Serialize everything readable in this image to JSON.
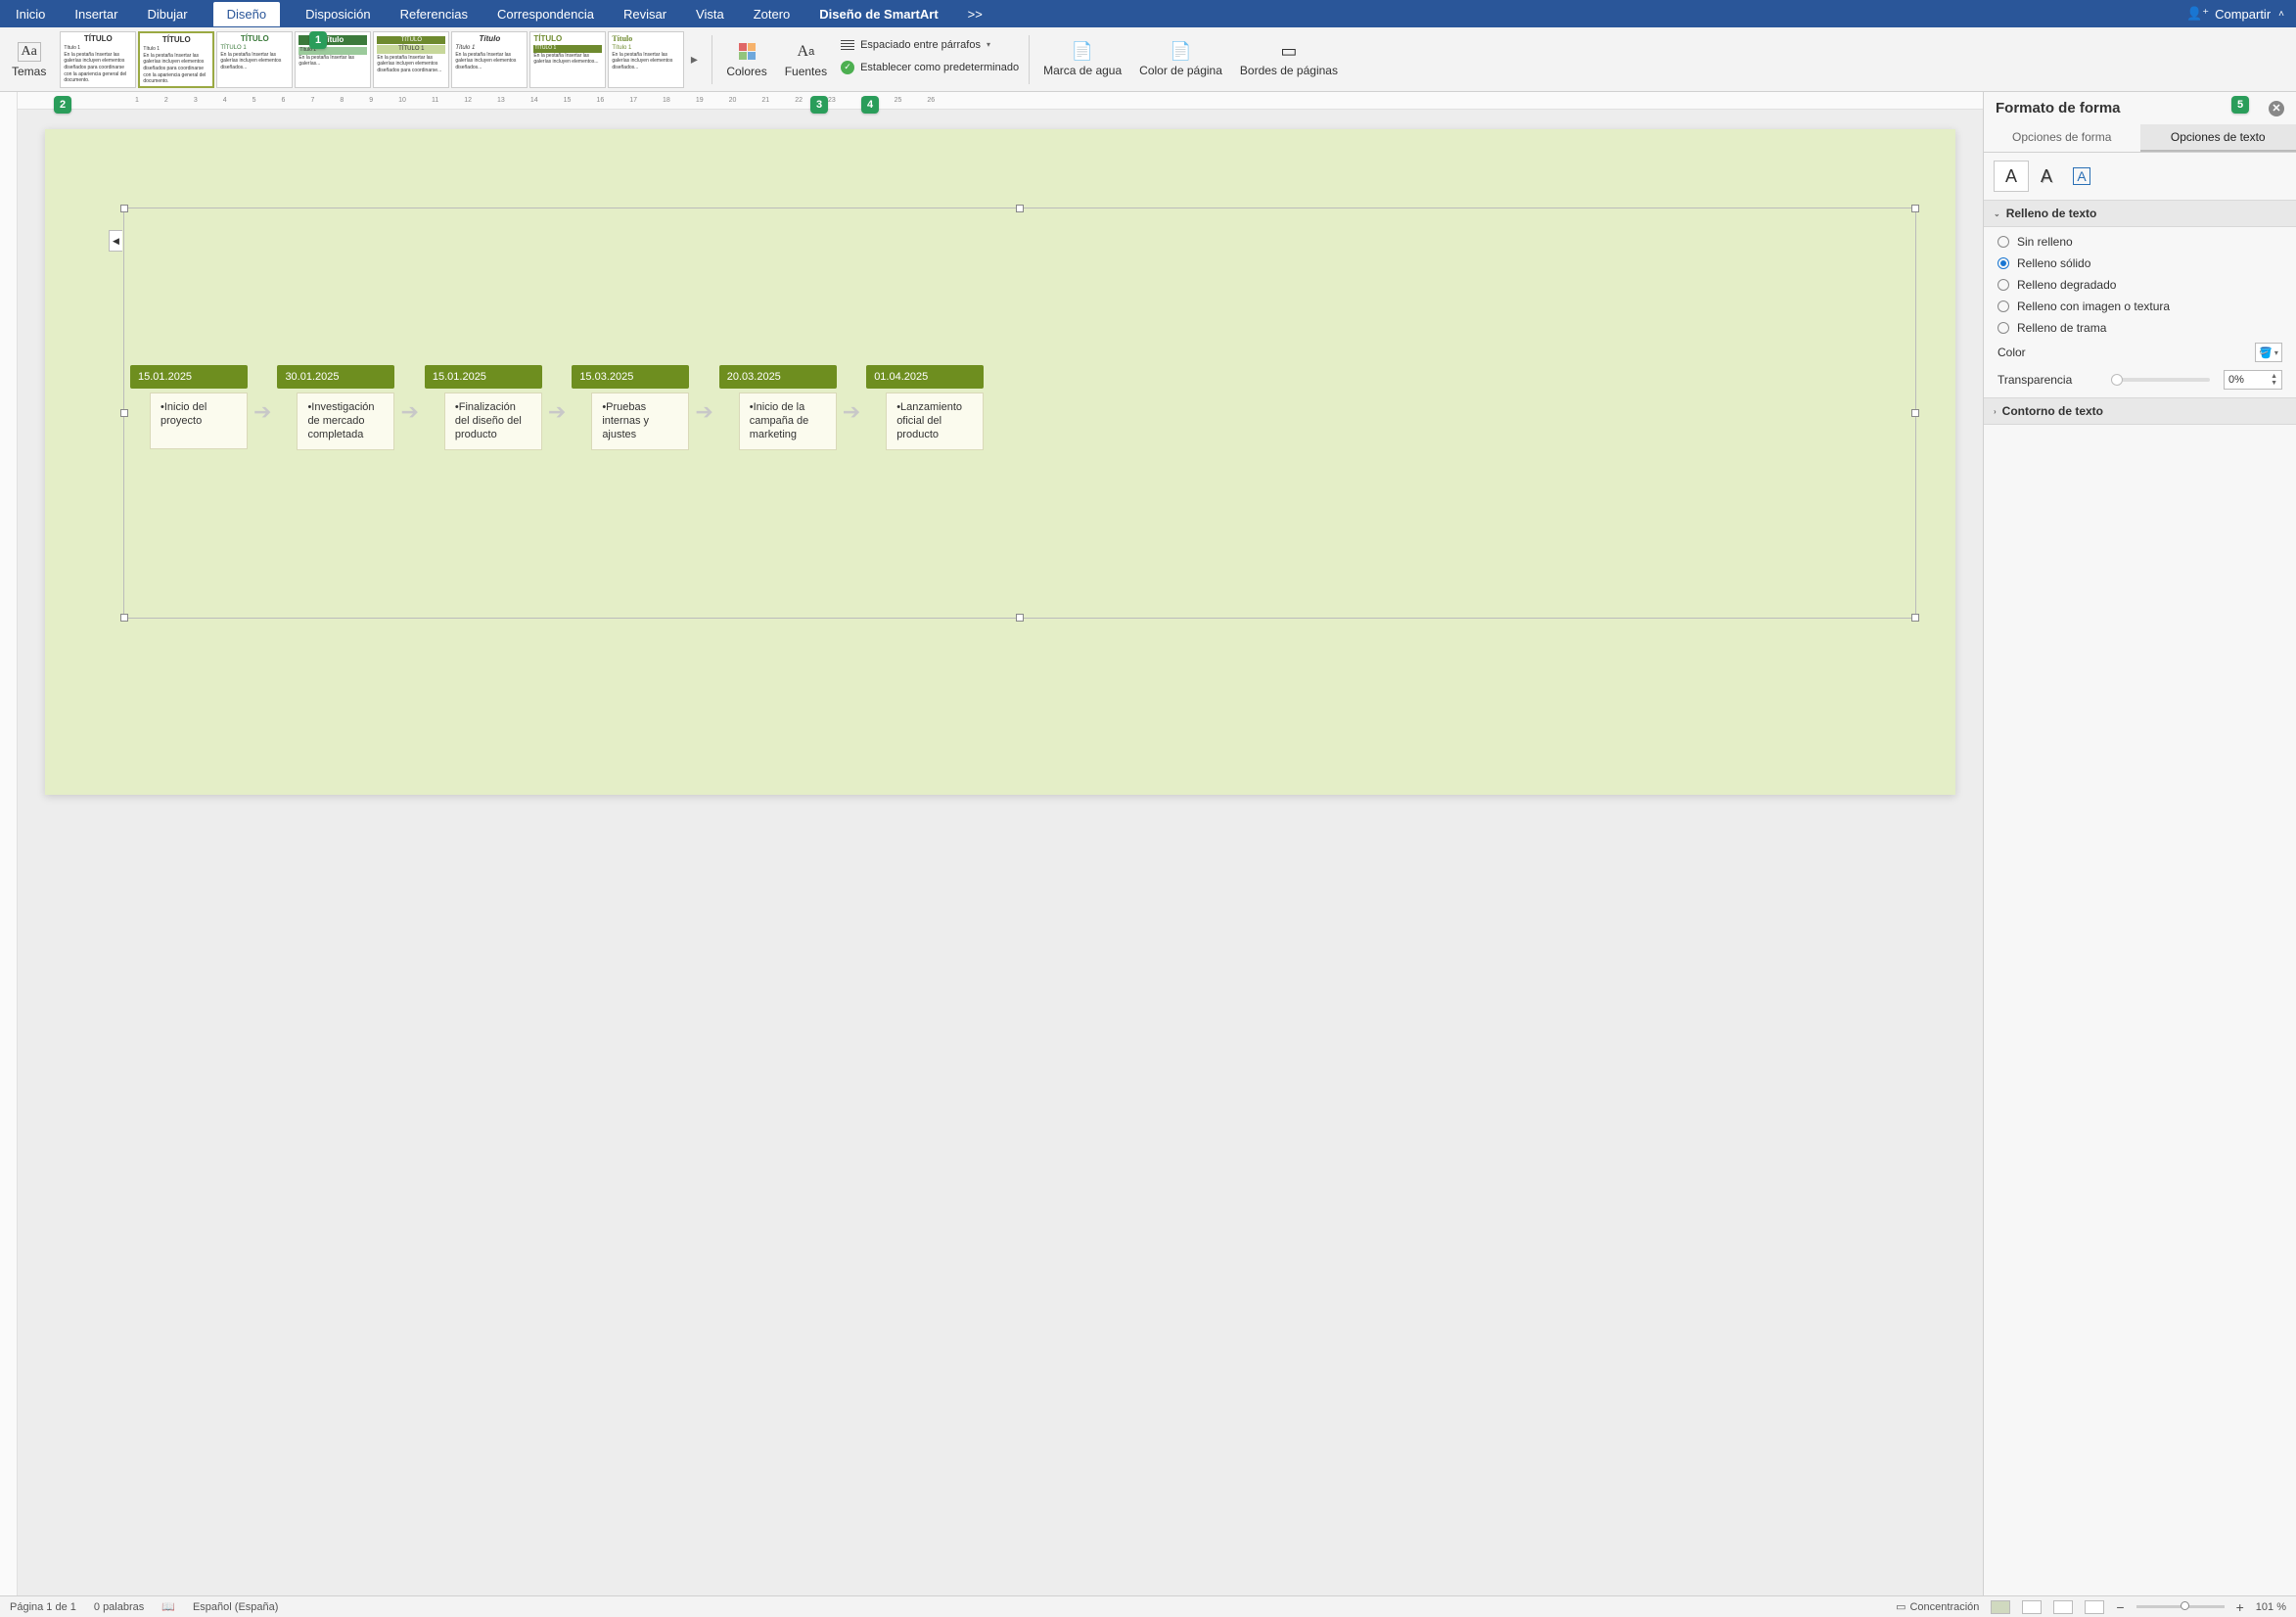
{
  "tabs": {
    "items": [
      "Inicio",
      "Insertar",
      "Dibujar",
      "Diseño",
      "Disposición",
      "Referencias",
      "Correspondencia",
      "Revisar",
      "Vista",
      "Zotero",
      "Diseño de SmartArt"
    ],
    "active": "Diseño",
    "overflow": ">>",
    "share": "Compartir"
  },
  "ribbon": {
    "themes": "Temas",
    "gallery": {
      "titles": [
        "TÍTULO",
        "TÍTULO",
        "TÍTULO",
        "Título",
        "TÍTULO",
        "Título",
        "TÍTULO",
        "Título"
      ],
      "more": "▸"
    },
    "colors": "Colores",
    "fonts": "Fuentes",
    "spacing": "Espaciado entre párrafos",
    "set_default": "Establecer como predeterminado",
    "watermark": "Marca de agua",
    "page_color": "Color de página",
    "page_borders": "Bordes de páginas"
  },
  "hints": [
    "1",
    "2",
    "3",
    "4",
    "5"
  ],
  "ruler": [
    "1",
    "2",
    "3",
    "4",
    "5",
    "6",
    "7",
    "8",
    "9",
    "10",
    "11",
    "12",
    "13",
    "14",
    "15",
    "16",
    "17",
    "18",
    "19",
    "20",
    "21",
    "22",
    "23",
    "24",
    "25",
    "26"
  ],
  "timeline": [
    {
      "date": "15.01.2025",
      "text": "Inicio del proyecto"
    },
    {
      "date": "30.01.2025",
      "text": "Investigación de mercado completada"
    },
    {
      "date": "15.01.2025",
      "text": "Finalización del diseño del producto"
    },
    {
      "date": "15.03.2025",
      "text": "Pruebas internas y ajustes"
    },
    {
      "date": "20.03.2025",
      "text": "Inicio de la campaña de marketing"
    },
    {
      "date": "01.04.2025",
      "text": "Lanzamiento oficial del producto"
    }
  ],
  "pane": {
    "title": "Formato de forma",
    "tab_shape": "Opciones de forma",
    "tab_text": "Opciones de texto",
    "section_fill": "Relleno de texto",
    "radios": {
      "none": "Sin relleno",
      "solid": "Relleno sólido",
      "gradient": "Relleno degradado",
      "picture": "Relleno con imagen o textura",
      "pattern": "Relleno de trama"
    },
    "color_label": "Color",
    "transparency_label": "Transparencia",
    "transparency_value": "0%",
    "section_outline": "Contorno de texto"
  },
  "status": {
    "page": "Página 1 de 1",
    "words": "0 palabras",
    "lang": "Español (España)",
    "focus": "Concentración",
    "zoom": "101 %"
  }
}
